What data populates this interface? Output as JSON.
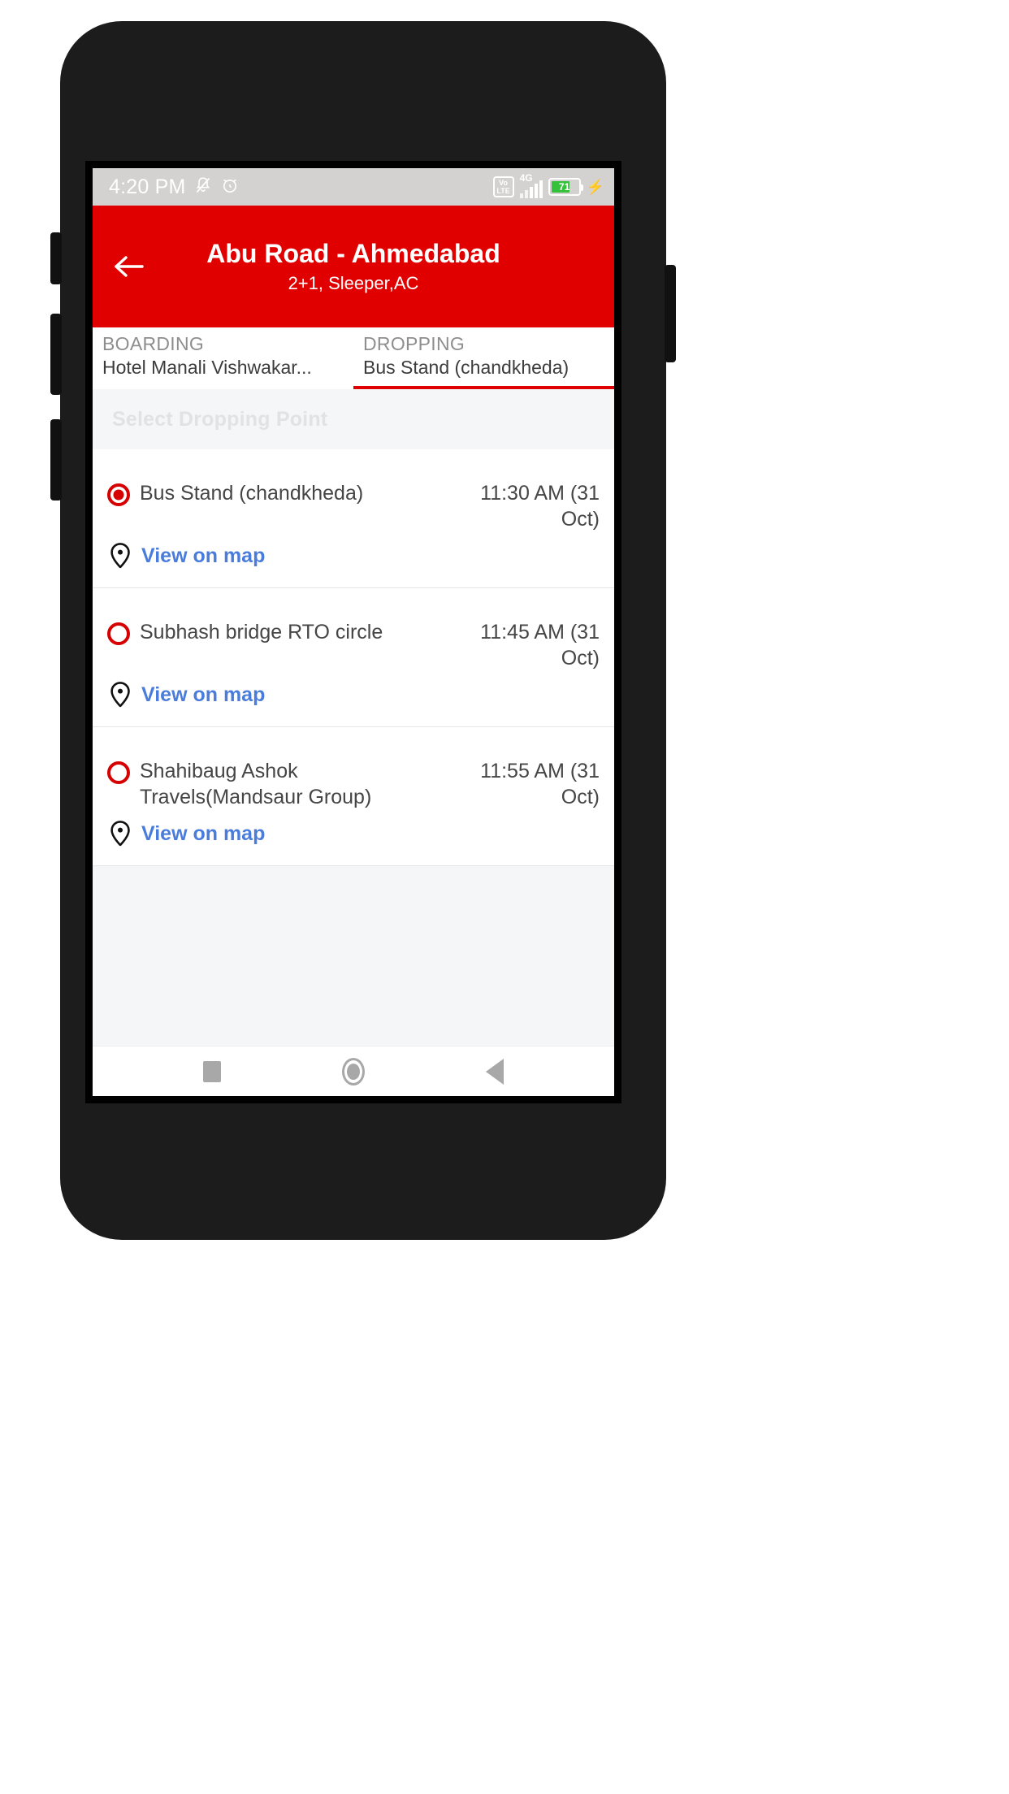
{
  "status_bar": {
    "time": "4:20 PM",
    "mute_icon": "bell-muted-icon",
    "alarm_icon": "alarm-clock-icon",
    "volte_top": "Vo",
    "volte_bottom": "LTE",
    "network": "4G",
    "battery_percent": "71",
    "charging_icon": "lightning-bolt-icon"
  },
  "app_bar": {
    "back_icon": "back-arrow-icon",
    "title": "Abu Road - Ahmedabad",
    "subtitle": "2+1, Sleeper,AC"
  },
  "tabs": [
    {
      "kicker": "BOARDING",
      "value": "Hotel Manali Vishwakar...",
      "active": false
    },
    {
      "kicker": "DROPPING",
      "value": "Bus Stand (chandkheda)",
      "active": true
    }
  ],
  "section": {
    "header": "Select Dropping Point"
  },
  "points": [
    {
      "name": "Bus Stand (chandkheda)",
      "time": "11:30 AM (31 Oct)",
      "selected": true,
      "map_link": "View on map",
      "map_icon": "map-pin-icon"
    },
    {
      "name": "Subhash bridge RTO circle",
      "time": "11:45 AM (31 Oct)",
      "selected": false,
      "map_link": "View on map",
      "map_icon": "map-pin-icon"
    },
    {
      "name": "Shahibaug Ashok Travels(Mandsaur Group)",
      "time": "11:55 AM (31 Oct)",
      "selected": false,
      "map_link": "View on map",
      "map_icon": "map-pin-icon"
    }
  ],
  "nav_bar": {
    "recents_icon": "square-recents-icon",
    "home_icon": "circle-home-icon",
    "back_icon": "triangle-back-icon"
  },
  "colors": {
    "brand_red": "#e00000",
    "radio_red": "#d60000",
    "link_blue": "#4a7ddb",
    "battery_green": "#35c13a",
    "status_bar_gray": "#d4d1d1",
    "page_gray": "#f5f6f8"
  }
}
